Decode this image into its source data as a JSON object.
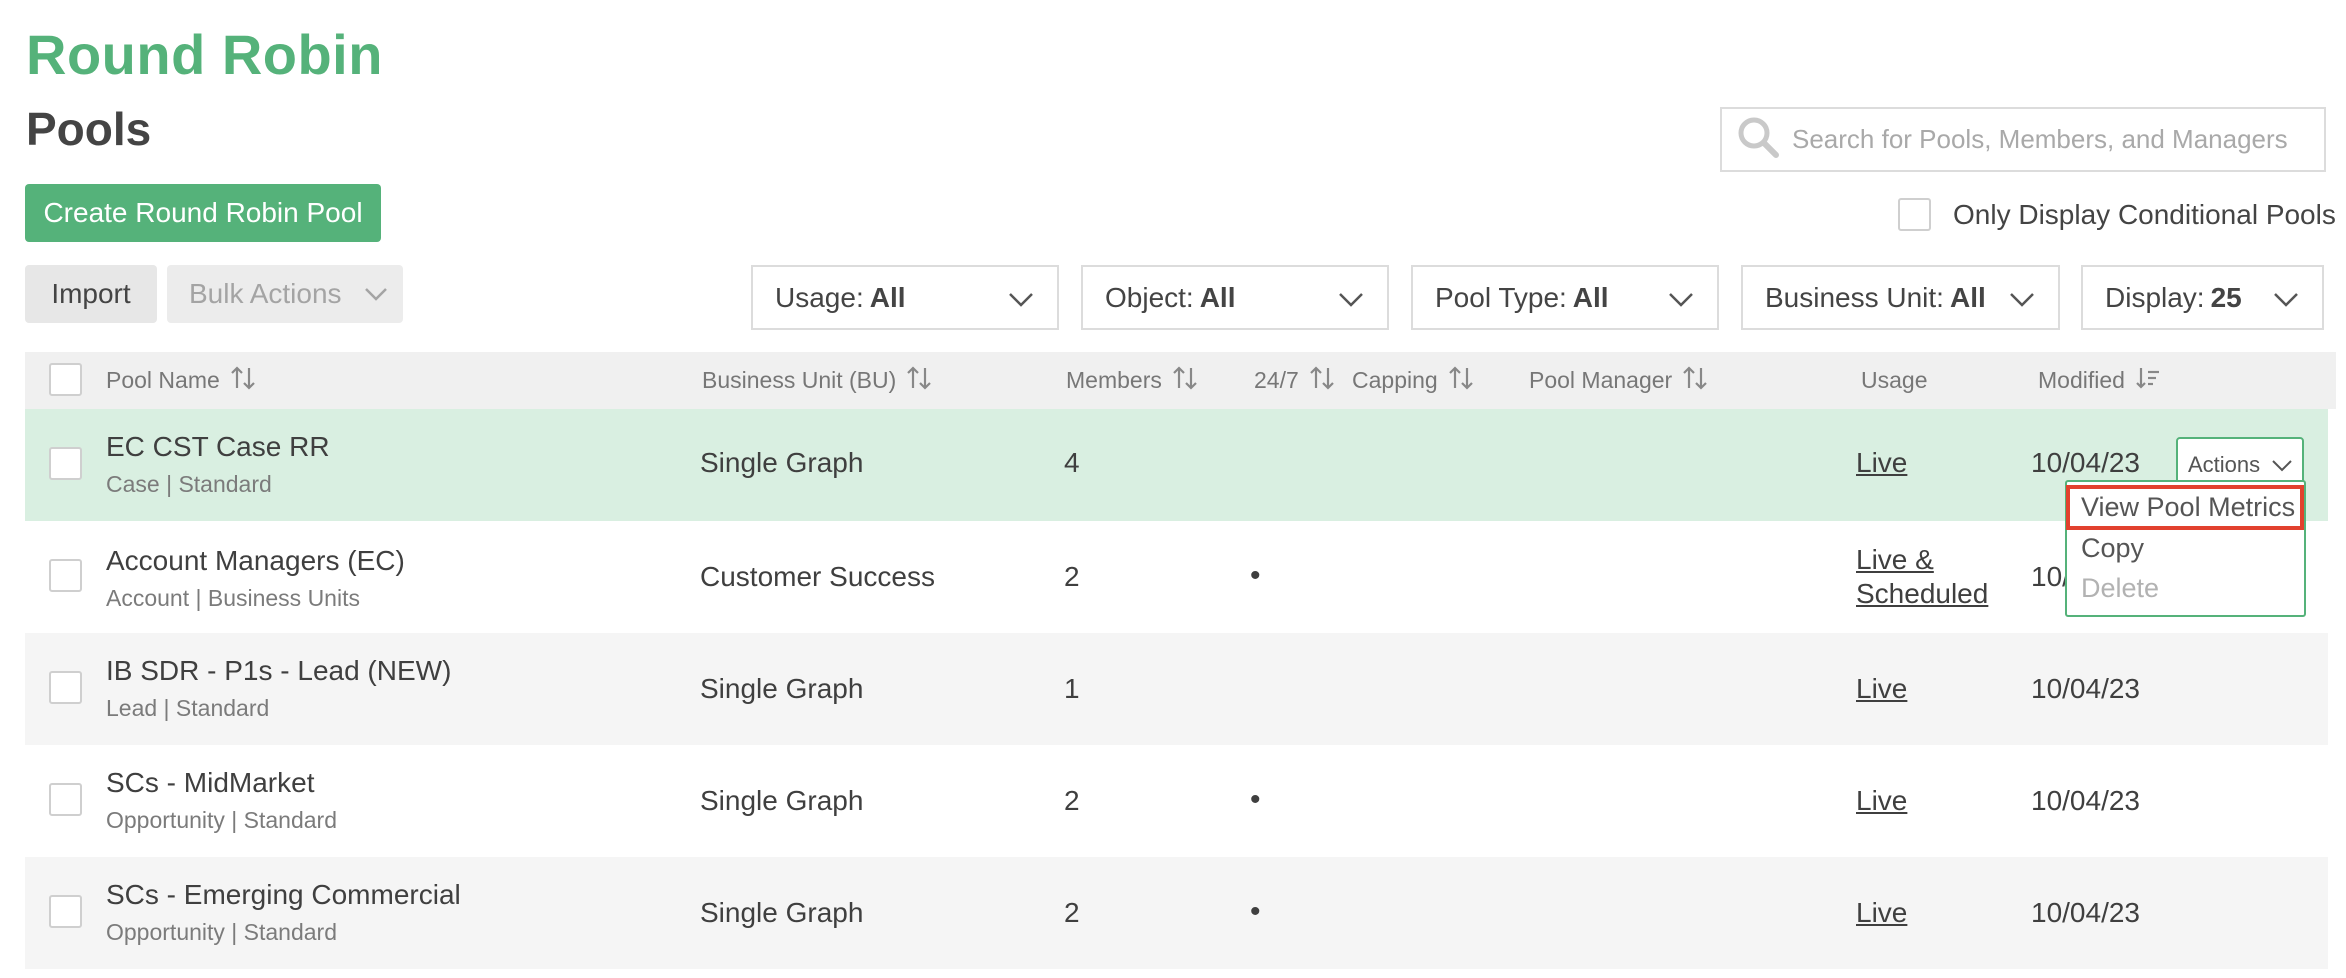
{
  "app": {
    "title": "Round Robin"
  },
  "page": {
    "title": "Pools"
  },
  "search": {
    "placeholder": "Search for Pools, Members, and Managers",
    "icon": "search-icon"
  },
  "toolbar": {
    "create_label": "Create Round Robin Pool",
    "conditional_label": "Only Display Conditional Pools",
    "import_label": "Import",
    "bulk_label": "Bulk Actions"
  },
  "filters": [
    {
      "label": "Usage:",
      "value": "All"
    },
    {
      "label": "Object:",
      "value": "All"
    },
    {
      "label": "Pool Type:",
      "value": "All"
    },
    {
      "label": "Business Unit:",
      "value": "All"
    },
    {
      "label": "Display:",
      "value": "25"
    }
  ],
  "table": {
    "headers": {
      "pool_name": "Pool Name",
      "business_unit": "Business Unit (BU)",
      "members": "Members",
      "always_on": "24/7",
      "capping": "Capping",
      "pool_manager": "Pool Manager",
      "usage": "Usage",
      "modified": "Modified"
    },
    "rows": [
      {
        "name": "EC CST Case RR",
        "sub": "Case | Standard",
        "bu": "Single Graph",
        "members": "4",
        "always_on": "",
        "usage1": "Live",
        "usage2": "",
        "modified": "10/04/23"
      },
      {
        "name": "Account Managers (EC)",
        "sub": "Account | Business Units",
        "bu": "Customer Success",
        "members": "2",
        "always_on": "•",
        "usage1": "Live &",
        "usage2": "Scheduled",
        "modified": "10/04/23"
      },
      {
        "name": "IB SDR - P1s - Lead (NEW)",
        "sub": "Lead | Standard",
        "bu": "Single Graph",
        "members": "1",
        "always_on": "",
        "usage1": "Live",
        "usage2": "",
        "modified": "10/04/23"
      },
      {
        "name": "SCs - MidMarket",
        "sub": "Opportunity | Standard",
        "bu": "Single Graph",
        "members": "2",
        "always_on": "•",
        "usage1": "Live",
        "usage2": "",
        "modified": "10/04/23"
      },
      {
        "name": "SCs - Emerging Commercial",
        "sub": "Opportunity | Standard",
        "bu": "Single Graph",
        "members": "2",
        "always_on": "•",
        "usage1": "Live",
        "usage2": "",
        "modified": "10/04/23"
      }
    ],
    "modified_partial": "10/"
  },
  "actions": {
    "label": "Actions",
    "menu": [
      "View Pool Metrics",
      "Copy",
      "Delete"
    ]
  },
  "colors": {
    "brand_green": "#55b27a",
    "selected_row": "#d9efe1",
    "highlight_red": "#e2412e"
  }
}
